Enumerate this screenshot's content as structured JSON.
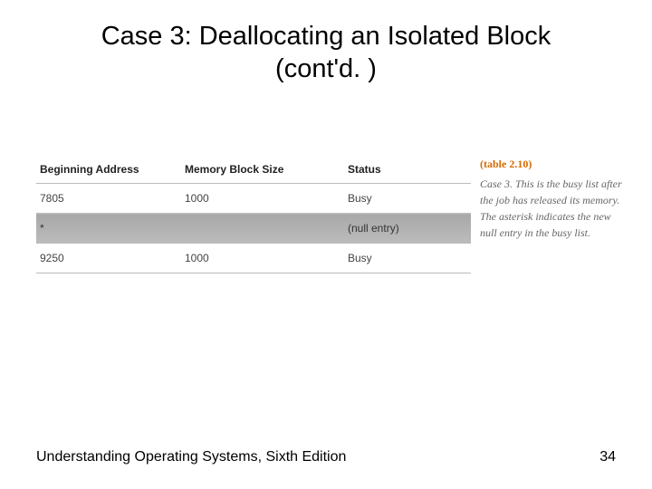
{
  "title_line1": "Case 3: Deallocating an Isolated Block",
  "title_line2": "(cont'd. )",
  "table": {
    "headers": {
      "addr": "Beginning Address",
      "size": "Memory Block Size",
      "status": "Status"
    },
    "rows": [
      {
        "addr": "7805",
        "size": "1000",
        "status": "Busy",
        "null": false
      },
      {
        "addr": "*",
        "size": "",
        "status": "(null entry)",
        "null": true
      },
      {
        "addr": "9250",
        "size": "1000",
        "status": "Busy",
        "null": false
      }
    ]
  },
  "sidebar": {
    "label": "(table 2.10)",
    "caption": "Case 3. This is the busy list after the job has released its memory. The asterisk indicates the new null entry in the busy list."
  },
  "footer": {
    "left": "Understanding Operating Systems, Sixth Edition",
    "right": "34"
  }
}
